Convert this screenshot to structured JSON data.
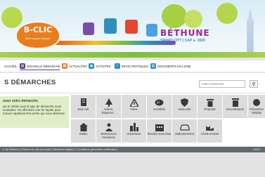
{
  "header": {
    "logo_title": "B-CLIC",
    "logo_subtitle": "Mon espace citoyen",
    "brand_city": "BÉTHUNE",
    "brand_tagline": "SMART CITY | CAP ► 2020"
  },
  "nav": {
    "items": [
      {
        "label": "ACCUEIL",
        "icon": "home",
        "color": ""
      },
      {
        "label": "NOUVELLE DÉMARCHE",
        "icon": "document-icon",
        "color": "#5b3a8f"
      },
      {
        "label": "ACTUALITÉS",
        "icon": "news-icon",
        "color": "#e97e1f"
      },
      {
        "label": "ACTIVITÉS",
        "icon": "activity-icon",
        "color": "#2f8fbf"
      },
      {
        "label": "INFOS PRATIQUES",
        "icon": "info-icon",
        "color": "#2f8fbf"
      },
      {
        "label": "DOCUMENTS EN LIGNE",
        "icon": "documents-icon",
        "color": "#2f8fbf"
      }
    ]
  },
  "main": {
    "title": "S DÉMARCHES",
    "search_placeholder": "votre recherche",
    "intro": {
      "heading": "ouez votre démarche",
      "text": "sur le métier puis le type de démarche vous souhaitez. Ou effectuez une he rapide pour trouver rapidement la arche qui vous intéresse"
    },
    "tiles": [
      {
        "label": "Etat civil",
        "icon": "civil-status-icon"
      },
      {
        "label": "Arbres, Espaces...",
        "icon": "tree-icon"
      },
      {
        "label": "Voirie",
        "icon": "warning-icon"
      },
      {
        "label": "Incivilités",
        "icon": "speech-icon"
      },
      {
        "label": "Insécurité",
        "icon": "shield-icon"
      },
      {
        "label": "Propreté",
        "icon": "trash-icon"
      },
      {
        "label": "Encombrants",
        "icon": "bin-icon"
      },
      {
        "label": "Prévention Médiati",
        "icon": "prevention-icon"
      },
      {
        "label": "Salles",
        "icon": "building-icon"
      },
      {
        "label": "Ressources Humaines",
        "icon": "people-icon"
      },
      {
        "label": "Urbanisme",
        "icon": "urban-icon"
      },
      {
        "label": "Rendez vous Elus",
        "icon": "meeting-icon"
      },
      {
        "label": "Stationnement",
        "icon": "car-icon"
      },
      {
        "label": "Chats errants",
        "icon": "cat-icon"
      }
    ]
  },
  "footer": {
    "text": "e de Béthune | Retour au site principal | Mentions légales | Conditions générales d'utilisation",
    "right": "HAUT"
  },
  "colors": {
    "accent_purple": "#5b3a8f",
    "accent_orange": "#e97e1f",
    "accent_blue": "#2f8fbf",
    "green_panel": "#dfeec7",
    "tile": "#dcdcdc"
  }
}
